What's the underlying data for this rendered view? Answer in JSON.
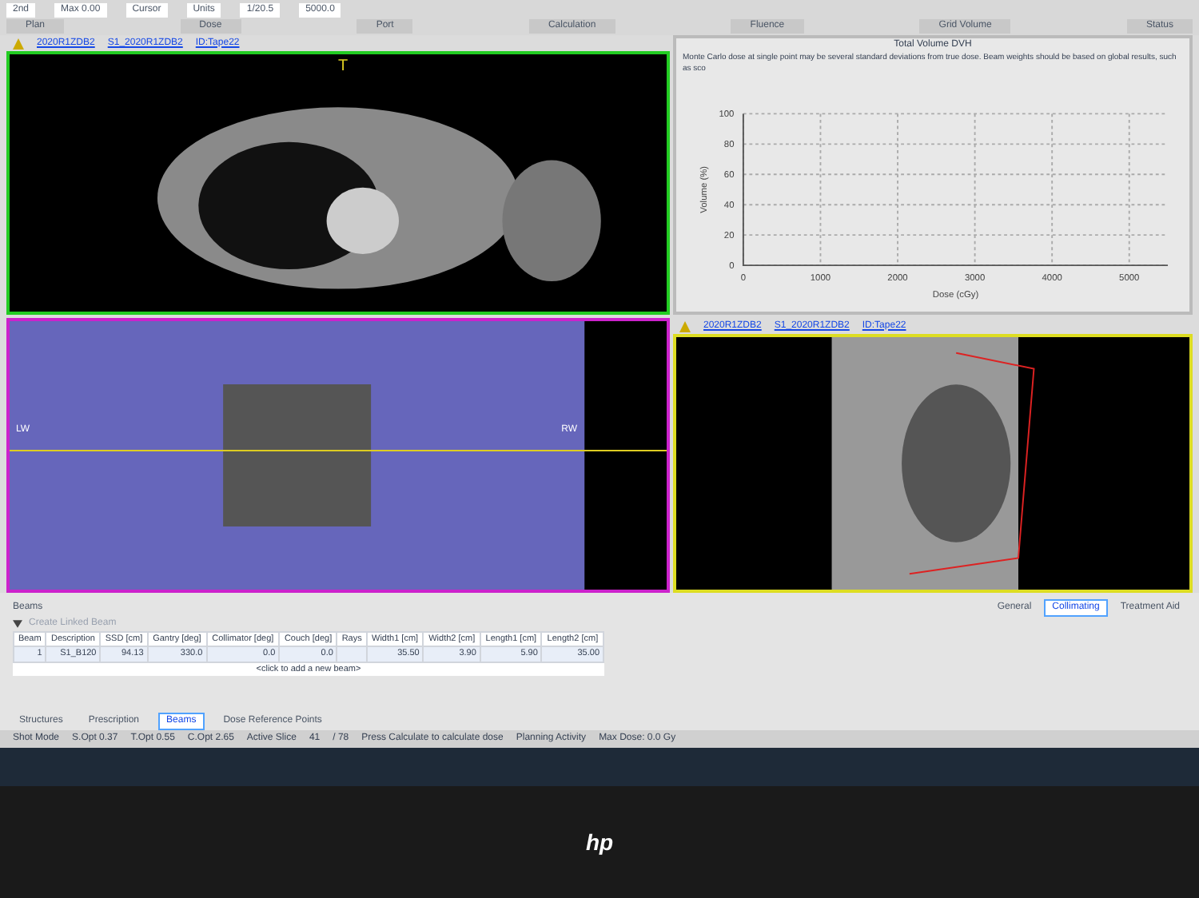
{
  "ribbon": {
    "groups": [
      "Plan",
      "Dose",
      "Port",
      "Calculation",
      "Fluence",
      "Grid Volume",
      "Status"
    ],
    "fields": [
      "2nd",
      "Max 0.00",
      "Cursor",
      "Units",
      "1/20.5",
      "5000.0"
    ]
  },
  "viewports": [
    {
      "kind": "axial",
      "labels": [
        "2020R1ZDB2",
        "S1_2020R1ZDB2",
        "ID:Tape22"
      ],
      "marker": "T"
    },
    {
      "kind": "chart",
      "title": "Total Volume DVH",
      "note": "Monte Carlo dose at single point may be several standard deviations from true dose. Beam weights should be based on global results, such as sco",
      "chart_data": {
        "type": "line",
        "xlabel": "Dose (cGy)",
        "ylabel": "Volume (%)",
        "xlim": [
          0,
          5500
        ],
        "ylim": [
          0,
          100
        ],
        "xticks": [
          0,
          1000,
          2000,
          3000,
          4000,
          5000
        ],
        "yticks": [
          0,
          20,
          40,
          60,
          80,
          100
        ],
        "grid": true
      }
    },
    {
      "kind": "coronal",
      "labels": [
        "LW",
        "RW"
      ]
    },
    {
      "kind": "sagittal",
      "labels": [
        "2020R1ZDB2",
        "S1_2020R1ZDB2",
        "ID:Tape22"
      ]
    }
  ],
  "beams": {
    "title": "Beams",
    "toolbar_label": "Create Linked Beam",
    "columns": [
      "Beam",
      "Description",
      "SSD [cm]",
      "Gantry [deg]",
      "Collimator [deg]",
      "Couch [deg]",
      "Rays",
      "Width1 [cm]",
      "Width2 [cm]",
      "Length1 [cm]",
      "Length2 [cm]"
    ],
    "rows": [
      {
        "selected": true,
        "cells": [
          "1",
          "S1_B120",
          "94.13",
          "330.0",
          "0.0",
          "0.0",
          "",
          "35.50",
          "3.90",
          "5.90",
          "35.00"
        ]
      }
    ],
    "add_row": "<click to add a new beam>",
    "tabs": [
      {
        "label": "Structures",
        "selected": false
      },
      {
        "label": "Prescription",
        "selected": false
      },
      {
        "label": "Beams",
        "selected": true
      },
      {
        "label": "Dose Reference Points",
        "selected": false
      }
    ],
    "side_tabs": [
      {
        "label": "General",
        "selected": false
      },
      {
        "label": "Collimating",
        "selected": true
      },
      {
        "label": "Treatment Aid",
        "selected": false
      }
    ]
  },
  "status_bar": [
    "Shot Mode",
    "S.Opt 0.37",
    "T.Opt 0.55",
    "C.Opt 2.65",
    "Active Slice",
    "41",
    "/ 78",
    "Press Calculate to calculate dose",
    "Planning Activity",
    "Max Dose: 0.0 Gy"
  ],
  "monitor": {
    "logo": "hp"
  }
}
